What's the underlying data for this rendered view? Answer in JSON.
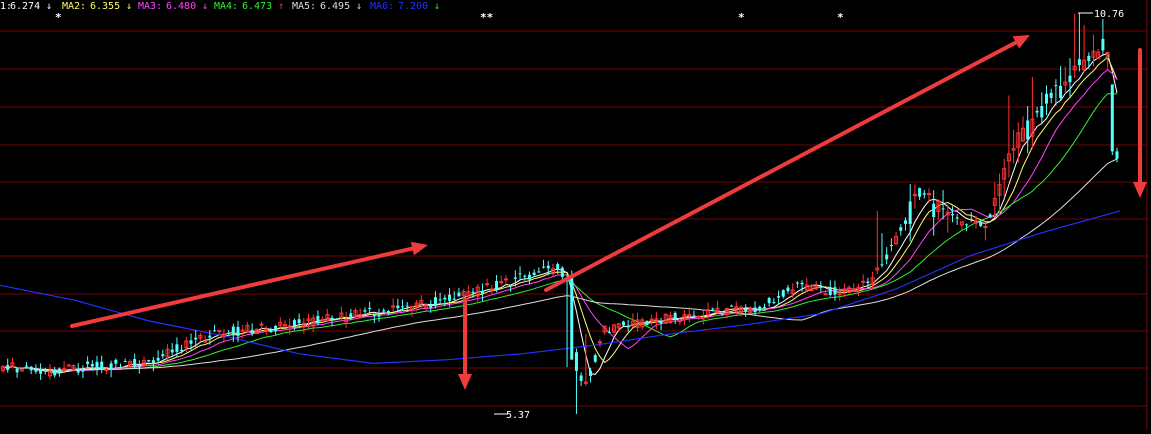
{
  "legend": [
    {
      "label": "1:",
      "value": "6.274",
      "arrow": "↓",
      "color": "#ffffff"
    },
    {
      "label": "MA2:",
      "value": "6.355",
      "arrow": "↓",
      "color": "#ffff66"
    },
    {
      "label": "MA3:",
      "value": "6.480",
      "arrow": "↓",
      "color": "#ff44ff"
    },
    {
      "label": "MA4:",
      "value": "6.473",
      "arrow": "↑",
      "color": "#33ee33"
    },
    {
      "label": "MA5:",
      "value": "6.495",
      "arrow": "↓",
      "color": "#dddddd"
    },
    {
      "label": "MA6:",
      "value": "7.200",
      "arrow": "↓",
      "color": "#2233ff"
    }
  ],
  "colors": {
    "background": "#000000",
    "grid": "#7a0000",
    "border": "#8b0000",
    "up_candle": "#ff3333",
    "down_candle": "#54ffff",
    "arrow": "#ee3b3b",
    "ma1": "#ffffff",
    "ma2": "#ffff66",
    "ma3": "#ff44ff",
    "ma4": "#33ee33",
    "ma5": "#dddddd",
    "ma6": "#2233ff"
  },
  "markers": [
    "*",
    "**",
    "*",
    "*"
  ],
  "chart_data": {
    "type": "candlestick",
    "title": "",
    "ylim": [
      5.2,
      10.9
    ],
    "high_label": "10.76",
    "low_label": "5.37",
    "high_value": 10.76,
    "low_value": 5.37,
    "ma6_values": [
      7.1,
      6.9,
      6.62,
      6.42,
      6.18,
      6.05,
      6.1,
      6.18,
      6.3,
      6.45,
      6.57,
      6.72,
      7.05,
      7.5,
      7.82,
      8.1
    ],
    "close_values": [
      6.0,
      5.95,
      6.02,
      6.06,
      6.45,
      6.55,
      6.7,
      6.85,
      7.0,
      7.2,
      7.34,
      7.22,
      6.0,
      5.75,
      6.5,
      6.6,
      6.68,
      6.8,
      7.1,
      7.0,
      7.15,
      8.3,
      8.0,
      7.9,
      8.9,
      9.5,
      10.0,
      10.2,
      10.3,
      10.0,
      9.0
    ]
  }
}
